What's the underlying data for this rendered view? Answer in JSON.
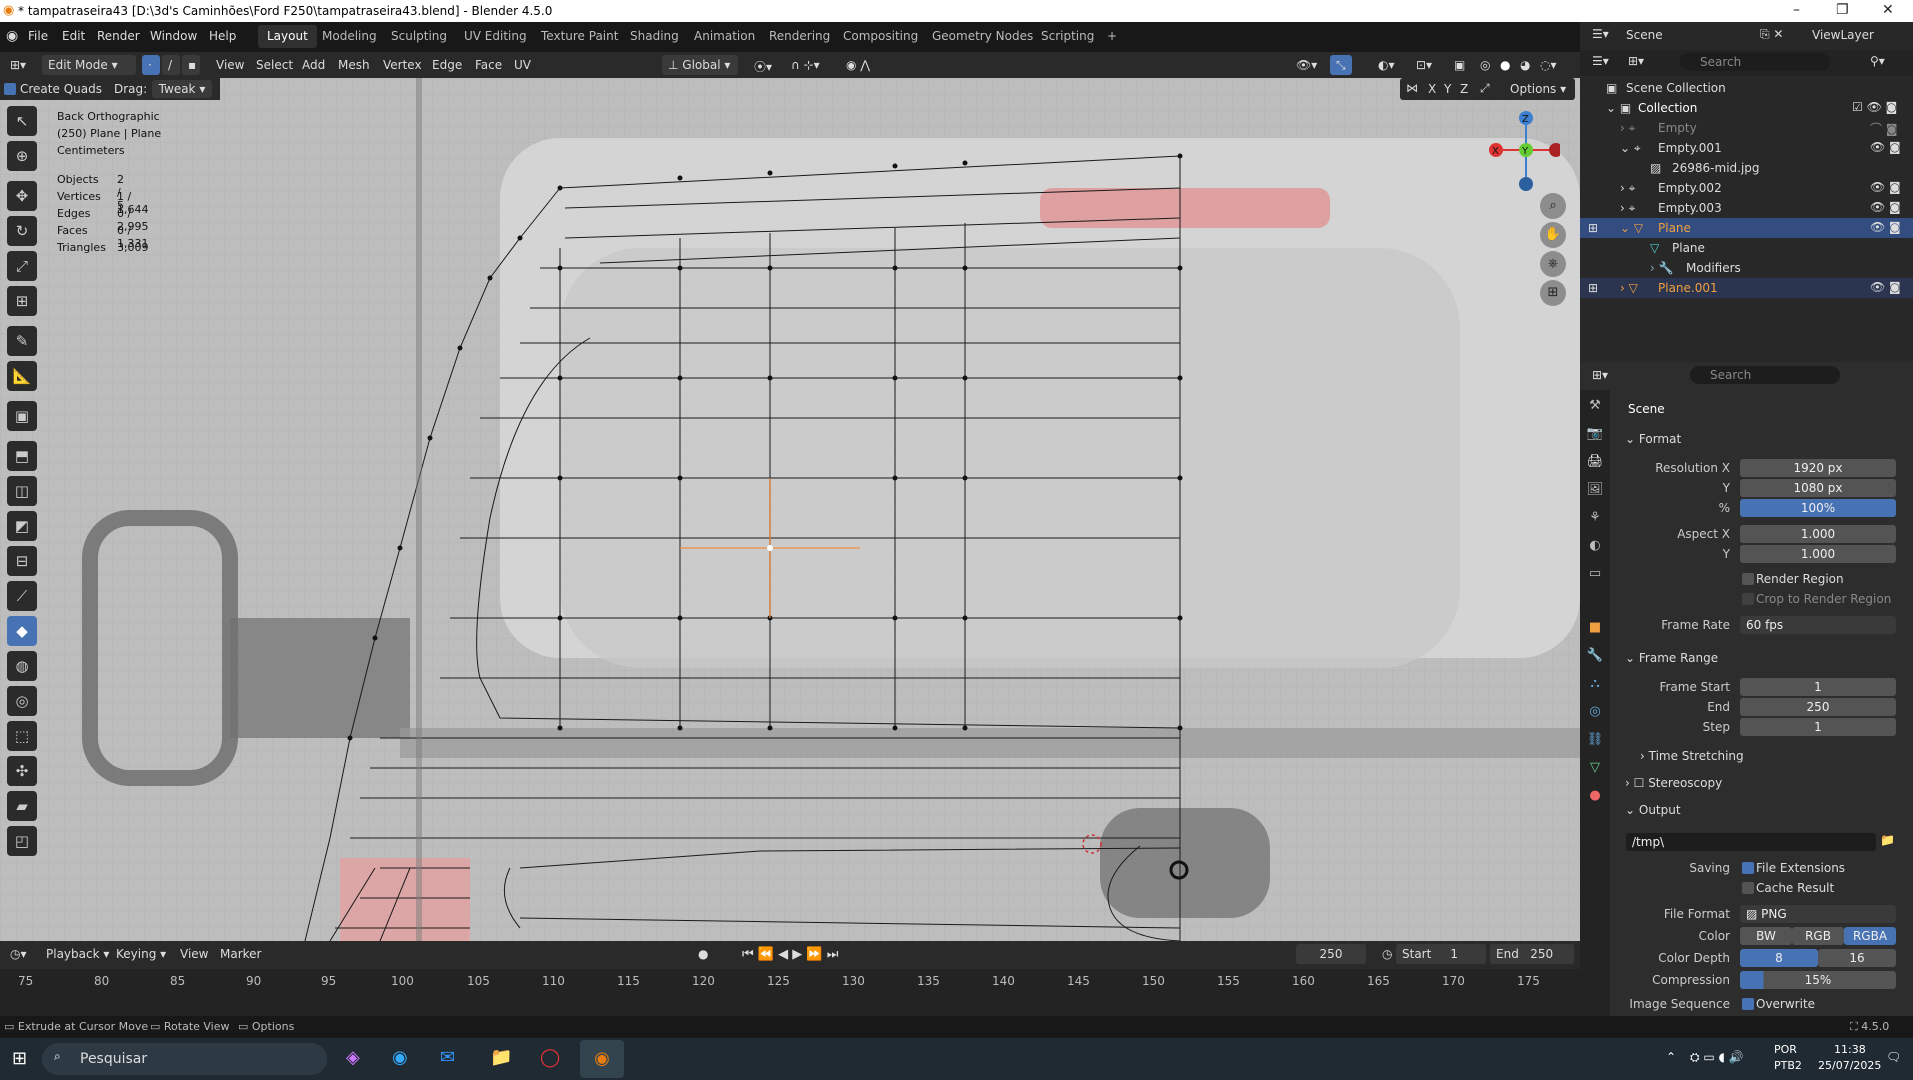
{
  "window": {
    "title": "* tampatraseira43 [D:\\3d's Caminhões\\Ford F250\\tampatraseira43.blend] - Blender 4.5.0",
    "minimize": "–",
    "maximize": "❐",
    "close": "✕"
  },
  "menu": [
    "File",
    "Edit",
    "Render",
    "Window",
    "Help"
  ],
  "workspaces": [
    "Layout",
    "Modeling",
    "Sculpting",
    "UV Editing",
    "Texture Paint",
    "Shading",
    "Animation",
    "Rendering",
    "Compositing",
    "Geometry Nodes",
    "Scripting",
    "+"
  ],
  "scene": {
    "label": "Scene",
    "viewlayer": "ViewLayer"
  },
  "vp_header": {
    "mode": "Edit Mode",
    "menus": [
      "View",
      "Select",
      "Add",
      "Mesh",
      "Vertex",
      "Edge",
      "Face",
      "UV"
    ],
    "orientation": "Global",
    "options": "Options",
    "axes": [
      "X",
      "Y",
      "Z"
    ]
  },
  "tool_opts": {
    "create_quads": "Create Quads",
    "drag": "Drag:",
    "drag_val": "Tweak"
  },
  "overlay": {
    "view": "Back Orthographic",
    "object": "(250) Plane | Plane",
    "units": "Centimeters",
    "stats": [
      {
        "k": "Objects",
        "v": "2 / 5"
      },
      {
        "k": "Vertices",
        "v": "1 / 1,644"
      },
      {
        "k": "Edges",
        "v": "0 / 2,995"
      },
      {
        "k": "Faces",
        "v": "0 / 1,331"
      },
      {
        "k": "Triangles",
        "v": "3,009"
      }
    ]
  },
  "gizmo": {
    "z": "Z",
    "y": "Y",
    "x": "X"
  },
  "timeline": {
    "menus": [
      "Playback",
      "Keying",
      "View",
      "Marker"
    ],
    "current": "250",
    "start_label": "Start",
    "start": "1",
    "end_label": "End",
    "end": "250",
    "ticks": [
      "75",
      "80",
      "85",
      "90",
      "95",
      "100",
      "105",
      "110",
      "115",
      "120",
      "125",
      "130",
      "135",
      "140",
      "145",
      "150",
      "155",
      "160",
      "165",
      "170",
      "175"
    ]
  },
  "status": {
    "a": "Extrude at Cursor Move",
    "b": "Rotate View",
    "c": "Options",
    "version": "4.5.0"
  },
  "taskbar": {
    "search": "Pesquisar",
    "lang1": "POR",
    "lang2": "PTB2",
    "time": "11:38",
    "date": "25/07/2025"
  },
  "outliner": {
    "search": "Search",
    "rows": [
      {
        "name": "Scene Collection",
        "indent": 0
      },
      {
        "name": "Collection",
        "indent": 1
      },
      {
        "name": "Empty",
        "indent": 2
      },
      {
        "name": "Empty.001",
        "indent": 2
      },
      {
        "name": "26986-mid.jpg",
        "indent": 3
      },
      {
        "name": "Empty.002",
        "indent": 2
      },
      {
        "name": "Empty.003",
        "indent": 2
      },
      {
        "name": "Plane",
        "indent": 2
      },
      {
        "name": "Plane",
        "indent": 3
      },
      {
        "name": "Modifiers",
        "indent": 3
      },
      {
        "name": "Plane.001",
        "indent": 2
      }
    ]
  },
  "props": {
    "search": "Search",
    "scene": "Scene",
    "format": "Format",
    "res_x_label": "Resolution X",
    "res_x": "1920 px",
    "y_label": "Y",
    "res_y": "1080 px",
    "pct_label": "%",
    "pct": "100%",
    "aspect_label": "Aspect X",
    "aspect_x": "1.000",
    "aspect_y": "1.000",
    "render_region": "Render Region",
    "crop": "Crop to Render Region",
    "fps_label": "Frame Rate",
    "fps": "60 fps",
    "frame_range": "Frame Range",
    "fs_label": "Frame Start",
    "fs": "1",
    "end_label": "End",
    "end": "250",
    "step_label": "Step",
    "step": "1",
    "time_stretch": "Time Stretching",
    "stereo": "Stereoscopy",
    "output": "Output",
    "path": "/tmp\\",
    "saving": "Saving",
    "file_ext": "File Extensions",
    "cache": "Cache Result",
    "file_format_label": "File Format",
    "file_format": "PNG",
    "color_label": "Color",
    "bw": "BW",
    "rgb": "RGB",
    "rgba": "RGBA",
    "depth_label": "Color Depth",
    "d8": "8",
    "d16": "16",
    "comp_label": "Compression",
    "comp": "15%",
    "seq_label": "Image Sequence",
    "overwrite": "Overwrite"
  }
}
